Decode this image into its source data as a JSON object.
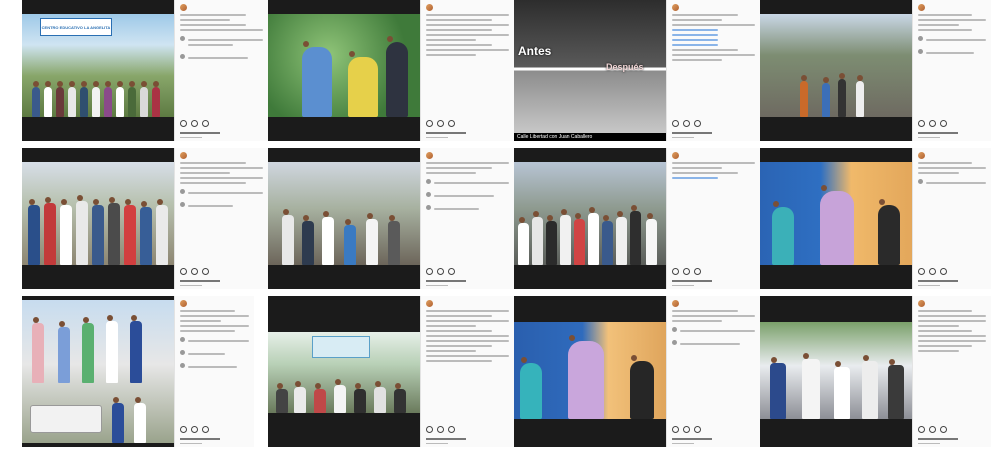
{
  "posts": [
    {
      "photo": "school-photo",
      "banner_text": "CENTRO EDUCATIVO LA ANGELITA"
    },
    {
      "photo": "speech-photo"
    },
    {
      "photo": "road-photo",
      "label_before": "Antes",
      "label_after": "Después",
      "caption": "Calle Libertad con Juan Caballero"
    },
    {
      "photo": "street-photo"
    },
    {
      "photo": "group-photo"
    },
    {
      "photo": "dig-photo"
    },
    {
      "photo": "crowd-photo"
    },
    {
      "photo": "talk-photo"
    },
    {
      "photo": "truck-photo"
    },
    {
      "photo": "meeting-photo"
    },
    {
      "photo": "talk2-photo"
    },
    {
      "photo": "crowd2-photo"
    }
  ]
}
